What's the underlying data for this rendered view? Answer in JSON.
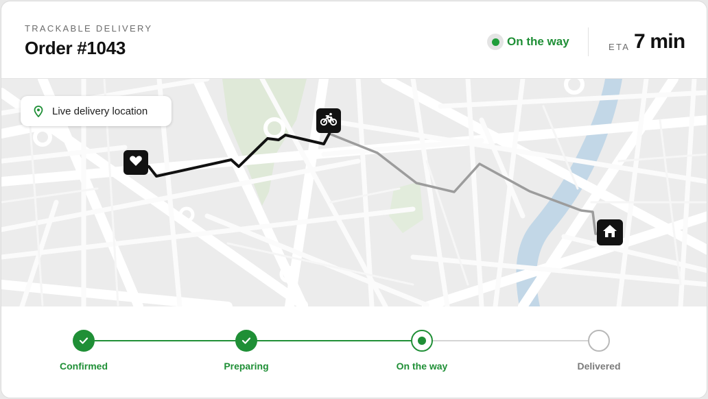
{
  "header": {
    "eyebrow": "TRACKABLE DELIVERY",
    "title": "Order #1043",
    "status": "On the way",
    "eta_label": "ETA",
    "eta_value": "7 min"
  },
  "map": {
    "live_label": "Live delivery location",
    "markers": {
      "start": "heart-icon",
      "courier": "bicycle-icon",
      "destination": "home-icon"
    }
  },
  "progress": {
    "steps": [
      {
        "label": "Confirmed",
        "state": "done"
      },
      {
        "label": "Preparing",
        "state": "done"
      },
      {
        "label": "On the way",
        "state": "current"
      },
      {
        "label": "Delivered",
        "state": "pending"
      }
    ]
  },
  "colors": {
    "accent": "#1f8f36",
    "route_done": "#111111",
    "route_remaining": "#9a9a9a",
    "river": "#bcd4e6",
    "park": "#dce9d4"
  }
}
